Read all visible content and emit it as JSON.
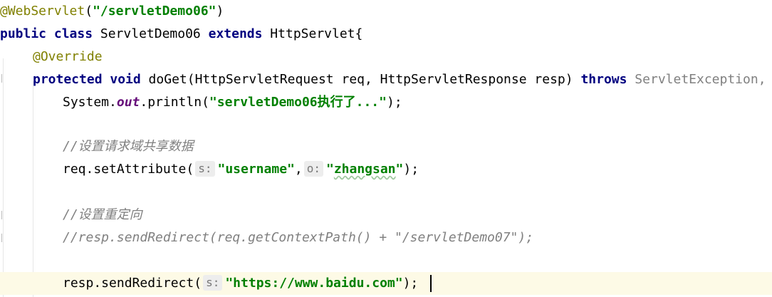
{
  "code": {
    "l1": {
      "ann": "@WebServlet",
      "open": "(",
      "str": "\"/servletDemo06\"",
      "close": ")"
    },
    "l2": {
      "kw1": "public class",
      "name": " ServletDemo06 ",
      "kw2": "extends",
      "rest": " HttpServlet{"
    },
    "l3": {
      "ann": "@Override"
    },
    "l4": {
      "kw": "protected void",
      "sig": " doGet(HttpServletRequest req, HttpServletResponse resp) ",
      "throws": "throws",
      "exc": " ServletException,"
    },
    "l5": {
      "pre": "System.",
      "field": "out",
      "mid": ".println(",
      "str": "\"servletDemo06执行了...\"",
      "post": ");"
    },
    "l6": {
      "comment": "//设置请求域共享数据"
    },
    "l7": {
      "pre": "req.setAttribute(",
      "hint1": "s:",
      "str1": "\"username\"",
      "sep": ",",
      "hint2": "o:",
      "str2_q1": "\"",
      "str2_word": "zhangsan",
      "str2_q2": "\"",
      "post": ");"
    },
    "l8": {
      "comment": "//设置重定向"
    },
    "l9": {
      "comment": "//resp.sendRedirect(req.getContextPath() + \"/servletDemo07\");"
    },
    "l10": {
      "pre": "resp.sendRedirect(",
      "hint": "s:",
      "str": "\"https://www.baidu.com\"",
      "post": ");"
    }
  },
  "colors": {
    "keyword": "#000080",
    "annotation": "#808000",
    "string": "#008000",
    "comment": "#808080",
    "field": "#660e7a",
    "current_line": "#fdfae6"
  }
}
